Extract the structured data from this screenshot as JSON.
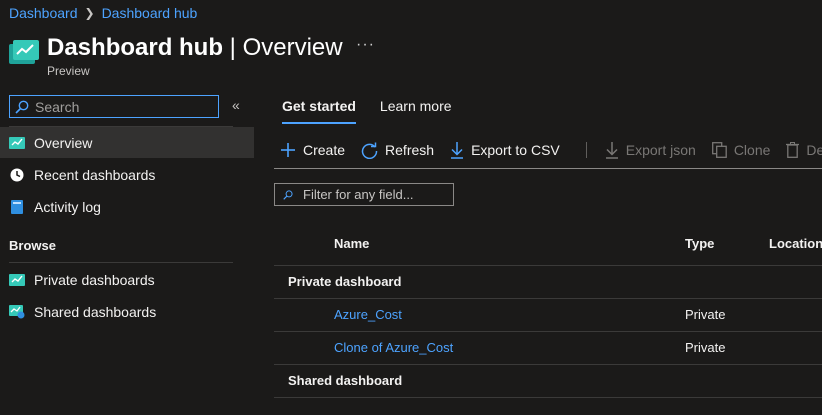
{
  "breadcrumb": [
    "Dashboard",
    "Dashboard hub"
  ],
  "header": {
    "title_bold": "Dashboard hub",
    "title_rest": " | Overview",
    "subtitle": "Preview",
    "more": "···"
  },
  "sidebar": {
    "search_placeholder": "Search",
    "collapse": "«",
    "items": [
      {
        "label": "Overview",
        "icon": "dashboard-icon"
      },
      {
        "label": "Recent dashboards",
        "icon": "clock-icon"
      },
      {
        "label": "Activity log",
        "icon": "log-icon"
      }
    ],
    "browse_label": "Browse",
    "browse_items": [
      {
        "label": "Private dashboards",
        "icon": "dashboard-icon"
      },
      {
        "label": "Shared dashboards",
        "icon": "shared-dashboard-icon"
      }
    ]
  },
  "tabs": [
    {
      "label": "Get started",
      "active": true
    },
    {
      "label": "Learn more",
      "active": false
    }
  ],
  "toolbar": {
    "create": "Create",
    "refresh": "Refresh",
    "export_csv": "Export to CSV",
    "export_json": "Export json",
    "clone": "Clone",
    "delete": "Del"
  },
  "filter": {
    "placeholder": "Filter for any field..."
  },
  "table": {
    "columns": [
      "Name",
      "Type",
      "Location"
    ],
    "groups": [
      {
        "label": "Private dashboard",
        "rows": [
          {
            "name": "Azure_Cost",
            "type": "Private"
          },
          {
            "name": "Clone of Azure_Cost",
            "type": "Private"
          }
        ]
      },
      {
        "label": "Shared dashboard",
        "rows": []
      }
    ]
  },
  "colors": {
    "accent": "#4da3ff",
    "background": "#1b1a19",
    "active_nav": "#323130"
  }
}
